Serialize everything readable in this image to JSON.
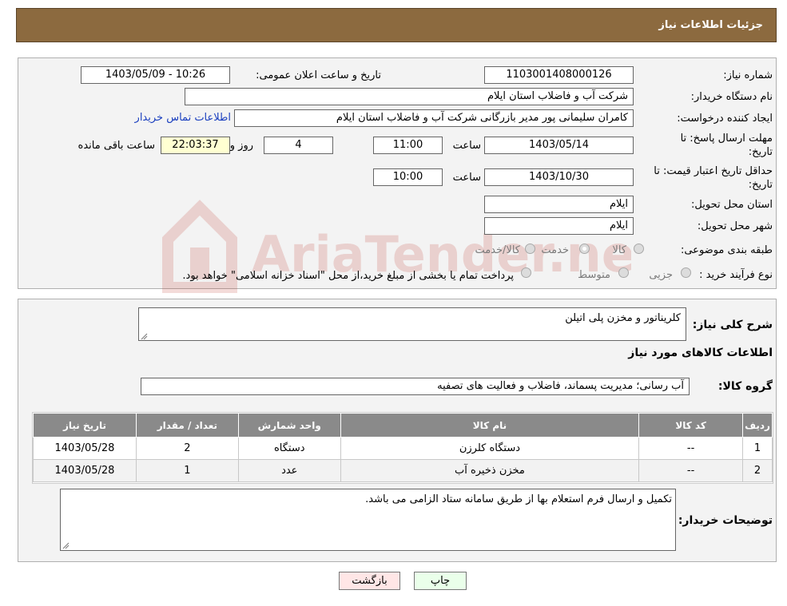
{
  "header": {
    "title": "جزئیات اطلاعات نیاز"
  },
  "fields": {
    "need_number_label": "شماره نیاز:",
    "need_number": "1103001408000126",
    "announce_label": "تاریخ و ساعت اعلان عمومی:",
    "announce_value": "1403/05/09 - 10:26",
    "buyer_org_label": "نام دستگاه خریدار:",
    "buyer_org": "شرکت آب و فاضلاب استان ایلام",
    "creator_label": "ایجاد کننده درخواست:",
    "creator": "کامران سلیمانی پور مدیر بازرگانی شرکت آب و فاضلاب استان ایلام",
    "contact_link": "اطلاعات تماس خریدار",
    "deadline_label_1": "مهلت ارسال پاسخ: تا",
    "deadline_label_2": "تاریخ:",
    "deadline_date": "1403/05/14",
    "time_label": "ساعت",
    "deadline_time": "11:00",
    "days": "4",
    "days_label": "روز و",
    "remaining": "22:03:37",
    "remaining_label": "ساعت باقی مانده",
    "validity_label_1": "حداقل تاریخ اعتبار قیمت: تا",
    "validity_label_2": "تاریخ:",
    "validity_date": "1403/10/30",
    "validity_time_label": "ساعت",
    "validity_time": "10:00",
    "province_label": "استان محل تحویل:",
    "province": "ایلام",
    "city_label": "شهر محل تحویل:",
    "city": "ایلام",
    "category_label": "طبقه بندی موضوعی:",
    "category_options": [
      "کالا",
      "خدمت",
      "کالا/خدمت"
    ],
    "process_label": "نوع فرآیند خرید :",
    "process_options": [
      "جزیی",
      "متوسط"
    ],
    "process_note": "پرداخت تمام یا بخشی از مبلغ خرید،از محل \"اسناد خزانه اسلامی\" خواهد بود."
  },
  "watermark": {
    "text": "AriaTender.neT"
  },
  "section2": {
    "summary_label": "شرح کلی نیاز:",
    "summary": "کلریناتور و مخزن پلی اتیلن",
    "items_heading": "اطلاعات کالاهای مورد نیاز",
    "group_label": "گروه کالا:",
    "group": "آب رسانی؛ مدیریت پسماند، فاضلاب و فعالیت های تصفیه",
    "table": {
      "headers": [
        "ردیف",
        "کد کالا",
        "نام کالا",
        "واحد شمارش",
        "تعداد / مقدار",
        "تاریخ نیاز"
      ],
      "rows": [
        [
          "1",
          "--",
          "دستگاه کلرزن",
          "دستگاه",
          "2",
          "1403/05/28"
        ],
        [
          "2",
          "--",
          "مخزن ذخیره آب",
          "عدد",
          "1",
          "1403/05/28"
        ]
      ]
    },
    "notes_label": "توضیحات خریدار:",
    "notes": "تکمیل و ارسال فرم استعلام بها از طریق سامانه ستاد الزامی می باشد."
  },
  "buttons": {
    "print": "چاپ",
    "back": "بازگشت"
  },
  "colors": {
    "header": "#8c6a3f",
    "link": "#1a3fbf",
    "print_bg": "#eaffea",
    "back_bg": "#ffe6e6",
    "yellow_box": "#ffffd2"
  }
}
